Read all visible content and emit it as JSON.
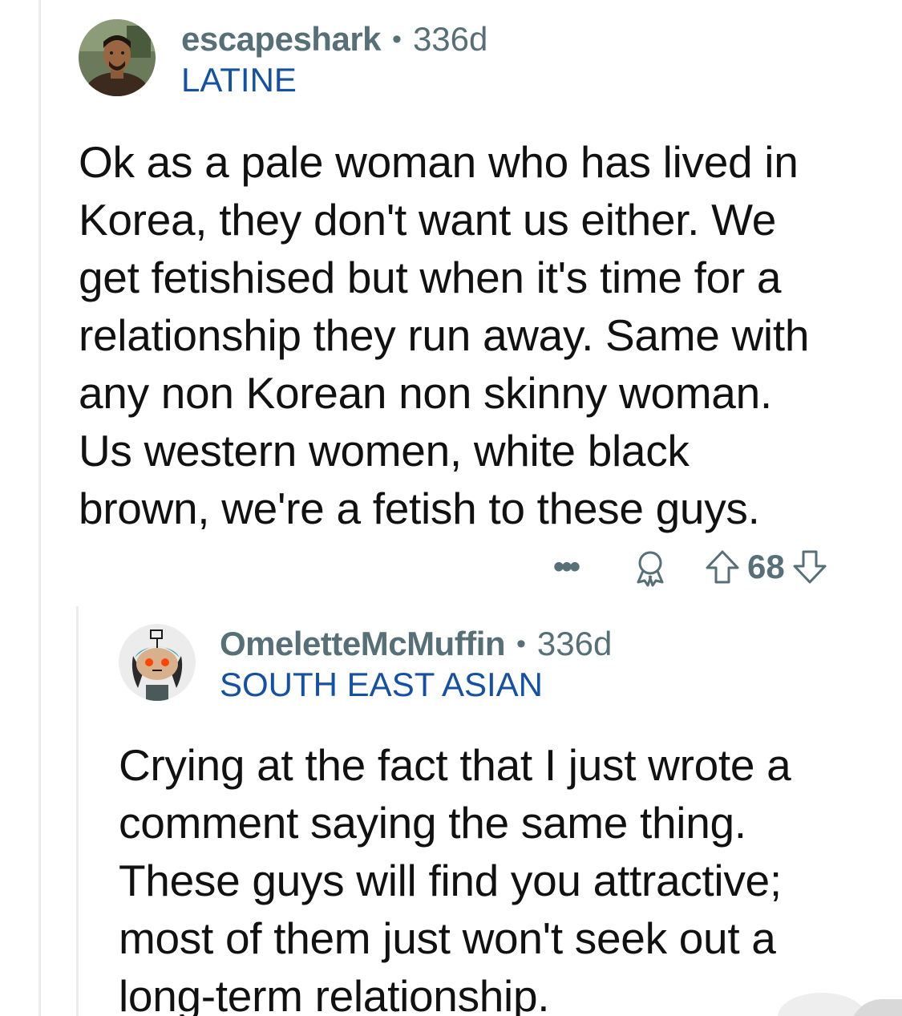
{
  "comments": [
    {
      "username": "escapeshark",
      "age": "336d",
      "flair": "LATINE",
      "body": "Ok as a pale woman who has lived in\nKorea, they don't want us either. We\nget fetishised but when it's time for a\nrelationship they run away. Same with\nany non Korean non skinny woman.\nUs western women, white black\nbrown, we're a fetish to these guys.",
      "score": "68",
      "icons": [
        "more-options-icon",
        "award-icon",
        "upvote-icon",
        "downvote-icon"
      ]
    },
    {
      "username": "OmeletteMcMuffin",
      "age": "336d",
      "flair": "SOUTH EAST ASIAN",
      "body": "Crying at the fact that I just wrote a\ncomment saying the same thing.\nThese guys will find you attractive;\nmost of them just won't seek out a\nlong-term relationship."
    }
  ],
  "separator": "•",
  "colors": {
    "meta": "#576f76",
    "flair": "#1450a3",
    "text": "#111111",
    "thread_line": "#ececec"
  }
}
